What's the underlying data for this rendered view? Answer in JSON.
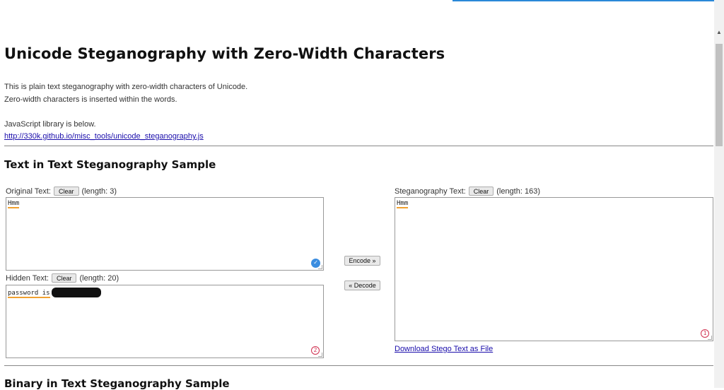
{
  "page": {
    "title": "Unicode Steganography with Zero-Width Characters",
    "intro_line1": "This is plain text steganography with zero-width characters of Unicode.",
    "intro_line2": "Zero-width characters is inserted within the words.",
    "library_note": "JavaScript library is below.",
    "library_link": "http://330k.github.io/misc_tools/unicode_steganography.js"
  },
  "text_section": {
    "heading": "Text in Text Steganography Sample",
    "original": {
      "label": "Original Text:",
      "clear_label": "Clear",
      "length": "(length: 3)",
      "value": "Hmm"
    },
    "hidden": {
      "label": "Hidden Text:",
      "clear_label": "Clear",
      "length": "(length: 20)",
      "value": "password is"
    },
    "stego": {
      "label": "Steganography Text:",
      "clear_label": "Clear",
      "length": "(length: 163)",
      "value": "Hmm"
    },
    "encode_label": "Encode »",
    "decode_label": "« Decode",
    "download_label": "Download Stego Text as File"
  },
  "binary_section": {
    "heading": "Binary in Text Steganography Sample"
  },
  "badges": {
    "hidden_badge": "2",
    "stego_badge": "1",
    "check": "✓"
  },
  "icons": [
    "check-icon",
    "number-2-icon",
    "number-1-icon",
    "scroll-up-icon"
  ],
  "colors": {
    "link": "#1a0dab",
    "spell_underline": "#f0a030",
    "badge": "#d03050",
    "check": "#3b8de0"
  }
}
